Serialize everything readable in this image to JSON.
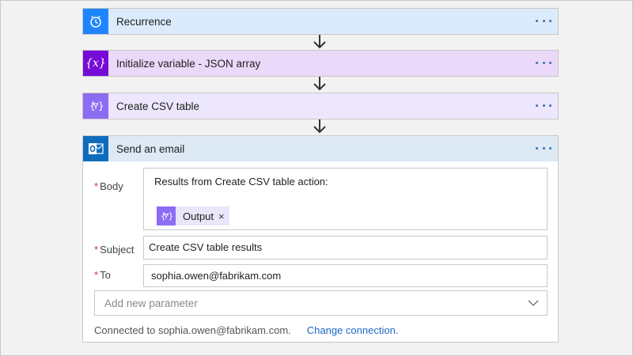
{
  "steps": [
    {
      "title": "Recurrence",
      "icon": "clock-icon",
      "color": "#1f85ff",
      "header_bg": "#dcebfb"
    },
    {
      "title": "Initialize variable - JSON array",
      "icon": "variable-icon",
      "color": "#770bd6",
      "header_bg": "#ead9f8"
    },
    {
      "title": "Create CSV table",
      "icon": "data-operation-icon",
      "color": "#8c6cf4",
      "header_bg": "#ede7fd"
    },
    {
      "title": "Send an email",
      "icon": "outlook-icon",
      "color": "#0f6cbd",
      "header_bg": "#dde9f5"
    }
  ],
  "email": {
    "body_label": "Body",
    "body_text": "Results from Create CSV table action:",
    "token_label": "Output",
    "token_remove": "×",
    "subject_label": "Subject",
    "subject_value": "Create CSV table results",
    "to_label": "To",
    "to_value": "sophia.owen@fabrikam.com",
    "required_marker": "*",
    "add_param_placeholder": "Add new parameter",
    "connected_text": "Connected to sophia.owen@fabrikam.com.",
    "change_connection": "Change connection."
  }
}
